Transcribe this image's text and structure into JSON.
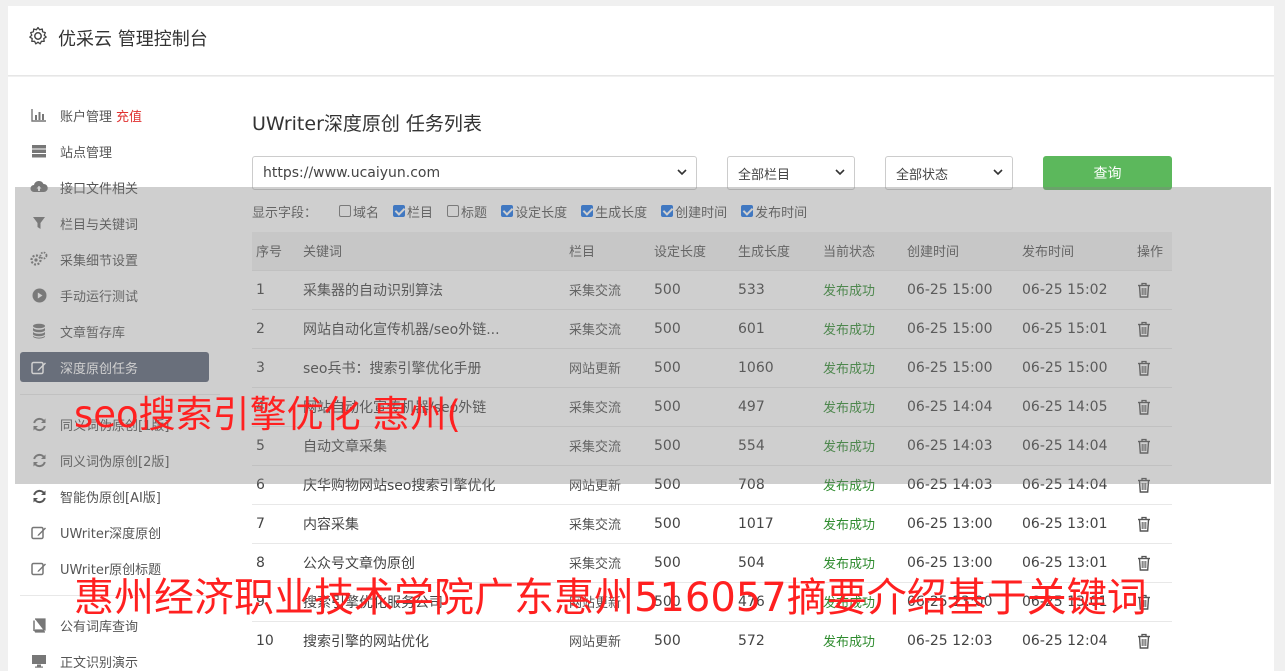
{
  "header": {
    "title": "优采云 管理控制台",
    "icon": "gear-icon"
  },
  "sidebar": {
    "items": [
      {
        "label": "账户管理",
        "extra": "充值",
        "icon": "bar-chart-icon"
      },
      {
        "label": "站点管理",
        "icon": "server-icon"
      },
      {
        "label": "接口文件相关",
        "icon": "cloud-upload-icon"
      },
      {
        "label": "栏目与关键词",
        "icon": "filter-icon"
      },
      {
        "label": "采集细节设置",
        "icon": "gears-icon"
      },
      {
        "label": "手动运行测试",
        "icon": "play-circle-icon"
      },
      {
        "label": "文章暂存库",
        "icon": "database-icon"
      },
      {
        "label": "深度原创任务",
        "icon": "edit-icon",
        "active": true
      },
      {
        "label": "同义词伪原创[1版]",
        "icon": "refresh-icon"
      },
      {
        "label": "同义词伪原创[2版]",
        "icon": "refresh-icon"
      },
      {
        "label": "智能伪原创[AI版]",
        "icon": "refresh-icon"
      },
      {
        "label": "UWriter深度原创",
        "icon": "edit-icon"
      },
      {
        "label": "UWriter原创标题",
        "icon": "edit-icon"
      },
      {
        "label": "公有词库查询",
        "icon": "book-icon"
      },
      {
        "label": "正文识别演示",
        "icon": "monitor-icon"
      }
    ]
  },
  "main": {
    "title": "UWriter深度原创 任务列表",
    "filters": {
      "site": "https://www.ucaiyun.com",
      "column": "全部栏目",
      "status": "全部状态",
      "query_label": "查询"
    },
    "fields_label": "显示字段：",
    "fields": [
      {
        "label": "域名",
        "checked": false
      },
      {
        "label": "栏目",
        "checked": true
      },
      {
        "label": "标题",
        "checked": false
      },
      {
        "label": "设定长度",
        "checked": true
      },
      {
        "label": "生成长度",
        "checked": true
      },
      {
        "label": "创建时间",
        "checked": true
      },
      {
        "label": "发布时间",
        "checked": true
      }
    ],
    "table": {
      "headers": [
        "序号",
        "关键词",
        "栏目",
        "设定长度",
        "生成长度",
        "当前状态",
        "创建时间",
        "发布时间",
        "操作"
      ],
      "rows": [
        [
          "1",
          "采集器的自动识别算法",
          "采集交流",
          "500",
          "533",
          "发布成功",
          "06-25 15:00",
          "06-25 15:02"
        ],
        [
          "2",
          "网站自动化宣传机器/seo外链...",
          "采集交流",
          "500",
          "601",
          "发布成功",
          "06-25 15:00",
          "06-25 15:01"
        ],
        [
          "3",
          "seo兵书：搜索引擎优化手册",
          "网站更新",
          "500",
          "1060",
          "发布成功",
          "06-25 15:00",
          "06-25 15:00"
        ],
        [
          "4",
          "网站自动化宣传机器/seo外链",
          "采集交流",
          "500",
          "497",
          "发布成功",
          "06-25 14:04",
          "06-25 14:05"
        ],
        [
          "5",
          "自动文章采集",
          "采集交流",
          "500",
          "554",
          "发布成功",
          "06-25 14:03",
          "06-25 14:04"
        ],
        [
          "6",
          "庆华购物网站seo搜索引擎优化",
          "网站更新",
          "500",
          "708",
          "发布成功",
          "06-25 14:03",
          "06-25 14:04"
        ],
        [
          "7",
          "内容采集",
          "采集交流",
          "500",
          "1017",
          "发布成功",
          "06-25 13:00",
          "06-25 13:01"
        ],
        [
          "8",
          "公众号文章伪原创",
          "采集交流",
          "500",
          "504",
          "发布成功",
          "06-25 13:00",
          "06-25 13:01"
        ],
        [
          "9",
          "搜索引擎优化服务公司",
          "网站更新",
          "500",
          "476",
          "发布成功",
          "06-25 13:00",
          "06-25 13:01"
        ],
        [
          "10",
          "搜索引擎的网站优化",
          "网站更新",
          "500",
          "572",
          "发布成功",
          "06-25 12:03",
          "06-25 12:04"
        ]
      ]
    }
  },
  "watermarks": {
    "line1": "seo搜索引擎优化 惠州(",
    "line2": "惠州经济职业技术学院广东惠州516057摘要介绍基于关键词"
  },
  "colors": {
    "accent": "#5cb85c",
    "active_nav": "#5b6478",
    "success": "#2e8b2e",
    "watermark": "#ff2020"
  }
}
